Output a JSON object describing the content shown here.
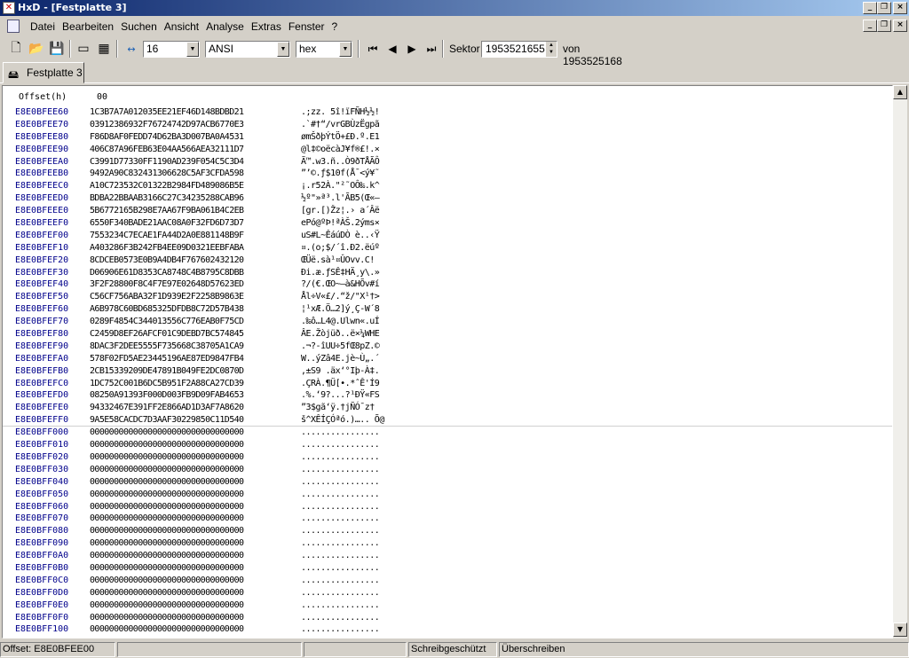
{
  "window": {
    "title": "HxD - [Festplatte 3]",
    "min": "_",
    "max": "□",
    "close": "×",
    "mdi_restore": "❐"
  },
  "menu": [
    "Datei",
    "Bearbeiten",
    "Suchen",
    "Ansicht",
    "Analyse",
    "Extras",
    "Fenster",
    "?"
  ],
  "toolbar": {
    "bytes_per_row": "16",
    "charset": "ANSI",
    "offset_base": "hex",
    "sector_label": "Sektor",
    "sector_value": "1953521655",
    "sector_total": "von 1953525168"
  },
  "tab": {
    "label": "Festplatte 3"
  },
  "hex": {
    "offset_header": "Offset(h)",
    "column_header": "00",
    "rows": [
      {
        "off": "E8E0BFEE60",
        "hex": "1C3B7A7A012035EE21EF46D148BDBD21",
        "txt": ".;zz. 5î!ïFÑH½½!"
      },
      {
        "off": "E8E0BFEE70",
        "hex": "03912386932F76724742D97ACB6770E3",
        "txt": ".`#†“/vrGBÙzËgpã"
      },
      {
        "off": "E8E0BFEE80",
        "hex": "F86D8AF0FEDD74D62BA3D007BA0A4531",
        "txt": "ømŠðþÝtÖ+£Ð.º.E1"
      },
      {
        "off": "E8E0BFEE90",
        "hex": "406C87A96FEB63E04AA566AEA32111D7",
        "txt": "@l‡©oëcàJ¥f®£!.×"
      },
      {
        "off": "E8E0BFEEA0",
        "hex": "C3991D77330FF1190AD239F054C5C3D4",
        "txt": "Ã™.w3.ñ..Ò9ðTÅÃÔ"
      },
      {
        "off": "E8E0BFEEB0",
        "hex": "9492A90C832431306628C5AF3CFDA598",
        "txt": "”’©.ƒ$10f(Å¯<ý¥˜"
      },
      {
        "off": "E8E0BFEEC0",
        "hex": "A10C723532C01322B2984FD489086B5E",
        "txt": "¡.r52À.\"²˜OÔ‰.k^"
      },
      {
        "off": "E8E0BFEED0",
        "hex": "BDBA22BBAAB3166C27C34235288CAB96",
        "txt": "½º\"»ª³.l'ÃB5(Œ«–"
      },
      {
        "off": "E8E0BFEEE0",
        "hex": "5B6772165B298E7AA67F9BA061B4C2EB",
        "txt": "[gr.[)Žz¦.› a´Âë"
      },
      {
        "off": "E8E0BFEEF0",
        "hex": "6550F340BADE21AAC08A0F32FD6D73D7",
        "txt": "ePó@ºÞ!ªÀŠ.2ýms×"
      },
      {
        "off": "E8E0BFEF00",
        "hex": "7553234C7ECAE1FA44D2A0E881148B9F",
        "txt": "uS#L~ÊáúDÒ è..‹Ÿ"
      },
      {
        "off": "E8E0BFEF10",
        "hex": "A403286F3B242FB4EE09D0321EEBFABA",
        "txt": "¤.(o;$/´î.Ð2.ëúº"
      },
      {
        "off": "E8E0BFEF20",
        "hex": "8CDCEB0573E0B9A4DB4F767602432120",
        "txt": "ŒÜë.sà¹¤ÛOvv.C! "
      },
      {
        "off": "E8E0BFEF30",
        "hex": "D06906E61D8353CA8748C4B8795C8DBB",
        "txt": "Ði.æ.ƒSÊ‡HÄ¸y\\.»"
      },
      {
        "off": "E8E0BFEF40",
        "hex": "3F2F28800F8C4F7E97E02648D57623ED",
        "txt": "?/(€.ŒO~—à&HÕv#í"
      },
      {
        "off": "E8E0BFEF50",
        "hex": "C56CF756ABA32F1D939E2F2258B9863E",
        "txt": "Ål÷V«£/.“ž/\"X¹†>"
      },
      {
        "off": "E8E0BFEF60",
        "hex": "A6B978C60BD685325DFDB8C72D57B438",
        "txt": "¦¹xÆ.Ö…2]ý¸Ç-W´8"
      },
      {
        "off": "E8E0BFEF70",
        "hex": "0289F4854C344013556C776EAB0F75CD",
        "txt": ".‰ô…L4@.Ulwn«.uÍ"
      },
      {
        "off": "E8E0BFEF80",
        "hex": "C2459D8EF26AFCF01C9DEBD7BC574845",
        "txt": "ÂE.Žòjüð..ë×¼WHE"
      },
      {
        "off": "E8E0BFEF90",
        "hex": "8DAC3F2DEE5555F735668C38705A1CA9",
        "txt": ".¬?-îUU÷5fŒ8pZ.©"
      },
      {
        "off": "E8E0BFEFA0",
        "hex": "578F02FD5AE23445196AE87ED9847FB4",
        "txt": "W..ýZâ4E.jè~Ù„.´"
      },
      {
        "off": "E8E0BFEFB0",
        "hex": "2CB15339209DE47891B049FE2DC0870D",
        "txt": ",±S9 .äx‘°Iþ-À‡."
      },
      {
        "off": "E8E0BFEFC0",
        "hex": "1DC752C001B6DC5B951F2A88CA27CD39",
        "txt": ".ÇRÀ.¶Ü[•.*ˆÊ'Í9"
      },
      {
        "off": "E8E0BFEFD0",
        "hex": "08250A91393F000D003FB9D09FAB4653",
        "txt": ".%.‘9?...?¹ÐŸ«FS"
      },
      {
        "off": "E8E0BFEFE0",
        "hex": "94332467E391FF2E866AD1D3AF7A8620",
        "txt": "”3$gã‘ÿ.†jÑÓ¯z† "
      },
      {
        "off": "E8E0BFEFF0",
        "hex": "9A5E58CACDC7D3AAF30229850C11D540",
        "txt": "š^XÊÍÇÓªó.)….. Õ@"
      },
      {
        "off": "E8E0BFF000",
        "hex": "00000000000000000000000000000000",
        "txt": "................"
      },
      {
        "off": "E8E0BFF010",
        "hex": "00000000000000000000000000000000",
        "txt": "................"
      },
      {
        "off": "E8E0BFF020",
        "hex": "00000000000000000000000000000000",
        "txt": "................"
      },
      {
        "off": "E8E0BFF030",
        "hex": "00000000000000000000000000000000",
        "txt": "................"
      },
      {
        "off": "E8E0BFF040",
        "hex": "00000000000000000000000000000000",
        "txt": "................"
      },
      {
        "off": "E8E0BFF050",
        "hex": "00000000000000000000000000000000",
        "txt": "................"
      },
      {
        "off": "E8E0BFF060",
        "hex": "00000000000000000000000000000000",
        "txt": "................"
      },
      {
        "off": "E8E0BFF070",
        "hex": "00000000000000000000000000000000",
        "txt": "................"
      },
      {
        "off": "E8E0BFF080",
        "hex": "00000000000000000000000000000000",
        "txt": "................"
      },
      {
        "off": "E8E0BFF090",
        "hex": "00000000000000000000000000000000",
        "txt": "................"
      },
      {
        "off": "E8E0BFF0A0",
        "hex": "00000000000000000000000000000000",
        "txt": "................"
      },
      {
        "off": "E8E0BFF0B0",
        "hex": "00000000000000000000000000000000",
        "txt": "................"
      },
      {
        "off": "E8E0BFF0C0",
        "hex": "00000000000000000000000000000000",
        "txt": "................"
      },
      {
        "off": "E8E0BFF0D0",
        "hex": "00000000000000000000000000000000",
        "txt": "................"
      },
      {
        "off": "E8E0BFF0E0",
        "hex": "00000000000000000000000000000000",
        "txt": "................"
      },
      {
        "off": "E8E0BFF0F0",
        "hex": "00000000000000000000000000000000",
        "txt": "................"
      },
      {
        "off": "E8E0BFF100",
        "hex": "00000000000000000000000000000000",
        "txt": "................"
      }
    ]
  },
  "status": {
    "offset": "Offset: E8E0BFEE00",
    "mode": "Schreibgeschützt",
    "overwrite": "Überschreiben"
  },
  "colors": {
    "offset_text": "#00008b",
    "titlebar_start": "#0a246a",
    "titlebar_end": "#a6caf0"
  }
}
